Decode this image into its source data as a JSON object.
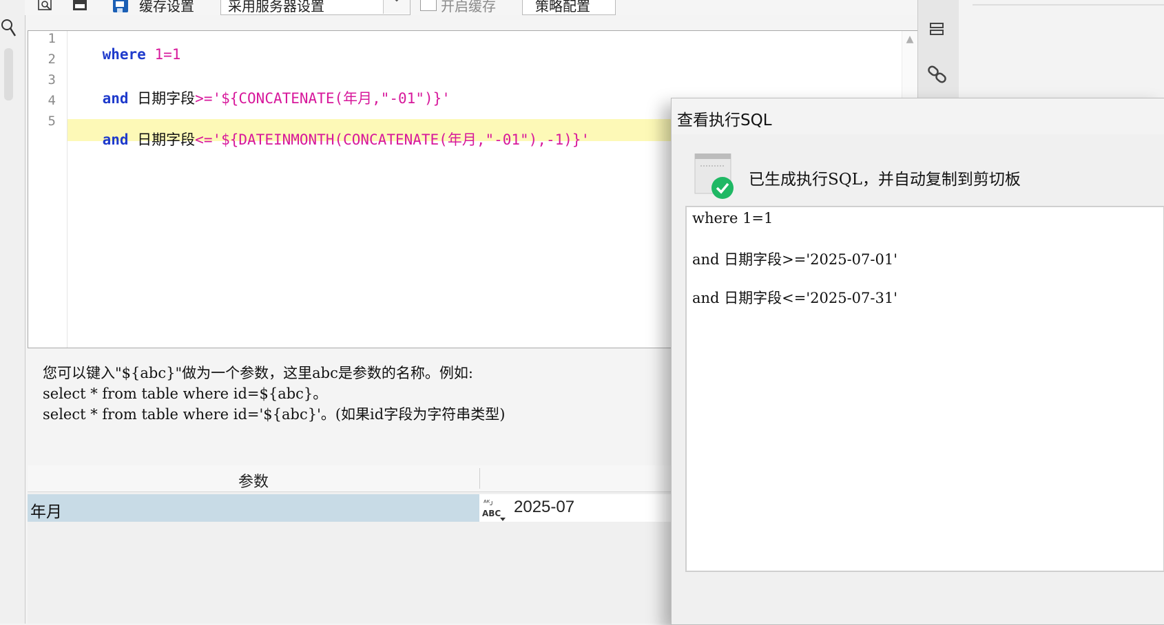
{
  "toolbar": {
    "cache_setting_label": "缓存设置",
    "cache_select_value": "采用服务器设置",
    "enable_cache_label": "开启缓存",
    "strategy_button_label": "策略配置"
  },
  "editor": {
    "lines": [
      {
        "num": "1",
        "kw": "where",
        "rest": " 1=1"
      },
      {
        "num": "2"
      },
      {
        "num": "3",
        "kw": "and",
        "field": " 日期字段",
        "op": ">='${CONCATENATE(年月,\"-01\")}'"
      },
      {
        "num": "4"
      },
      {
        "num": "5",
        "kw": "and",
        "field": " 日期字段",
        "op": "<='${DATEINMONTH(CONCATENATE(年月,\"-01\"),-1)}'"
      }
    ]
  },
  "help": {
    "line1": "您可以键入\"${abc}\"做为一个参数，这里abc是参数的名称。例如:",
    "line2": "select * from table where id=${abc}。",
    "line3": "select * from table where id='${abc}'。(如果id字段为字符串类型)"
  },
  "params": {
    "header_label": "参数",
    "rows": [
      {
        "name": "年月",
        "value": "2025-07"
      }
    ]
  },
  "dialog": {
    "title": "查看执行SQL",
    "message": "已生成执行SQL，并自动复制到剪切板",
    "sql_lines": [
      "where 1=1",
      "and 日期字段>='2025-07-01'",
      "and 日期字段<='2025-07-31'"
    ]
  },
  "colors": {
    "keyword": "#1f3bcc",
    "string": "#d7189b",
    "highlight_line": "#fdf9b7",
    "selected_row": "#c8dbe6",
    "success": "#1fb864"
  },
  "icons": [
    "find-icon",
    "sql-icon",
    "save-icon",
    "dropdown-arrow-icon",
    "search-icon",
    "align-icon",
    "link-icon",
    "success-check-icon",
    "type-abc-icon"
  ]
}
